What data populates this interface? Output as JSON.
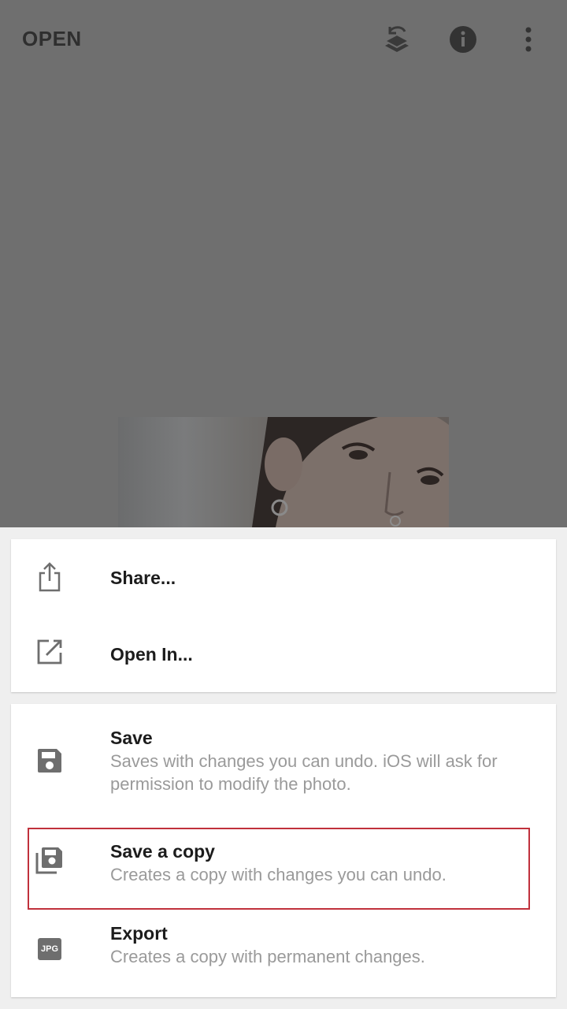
{
  "topbar": {
    "open_label": "OPEN",
    "icons": [
      "revert-layers-icon",
      "info-icon",
      "more-vertical-icon"
    ]
  },
  "menu": {
    "group1": [
      {
        "icon": "share-icon",
        "title": "Share..."
      },
      {
        "icon": "open-in-icon",
        "title": "Open In..."
      }
    ],
    "save": {
      "icon": "save-icon",
      "title": "Save",
      "desc": "Saves with changes you can undo. iOS will ask for permission to modify the photo."
    },
    "save_copy": {
      "icon": "save-copy-icon",
      "title": "Save a copy",
      "desc": "Creates a copy with changes you can undo."
    },
    "export": {
      "icon": "jpg-icon",
      "badge": "JPG",
      "title": "Export",
      "desc": "Creates a copy with permanent changes."
    }
  },
  "colors": {
    "overlay": "#6f6f6f",
    "sheet_bg": "#efefef",
    "title_text": "#1c1c1c",
    "desc_text": "#9a9a9a",
    "highlight_border": "#c0313c",
    "icon_gray": "#6e6e6e"
  }
}
